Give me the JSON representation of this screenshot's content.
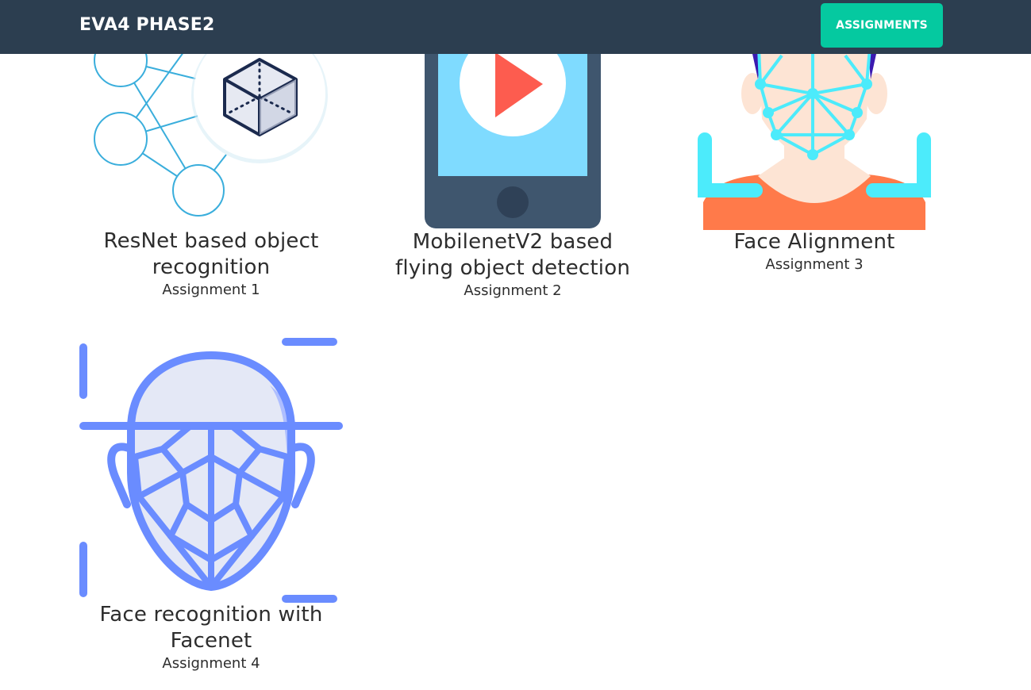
{
  "navbar": {
    "brand": "EVA4 PHASE2",
    "assignments_button": "ASSIGNMENTS"
  },
  "cards": [
    {
      "title": "ResNet based object recognition",
      "subtitle": "Assignment 1",
      "icon": "neural-network-cube-icon"
    },
    {
      "title": "MobilenetV2 based flying object detection",
      "subtitle": "Assignment 2",
      "icon": "tablet-play-icon"
    },
    {
      "title": "Face Alignment",
      "subtitle": "Assignment 3",
      "icon": "face-landmarks-icon"
    },
    {
      "title": "Face recognition with Facenet",
      "subtitle": "Assignment 4",
      "icon": "face-scan-icon"
    }
  ],
  "colors": {
    "navbar_bg": "#2c3e50",
    "button_bg": "#05c9a0",
    "network_line": "#3aaedc",
    "play_red": "#fd5c4f",
    "tablet_body": "#3f566e",
    "tablet_screen": "#7fdbff",
    "face_mesh": "#4cebfb",
    "shirt": "#ff7a4a",
    "face_scan": "#6a8cff"
  }
}
